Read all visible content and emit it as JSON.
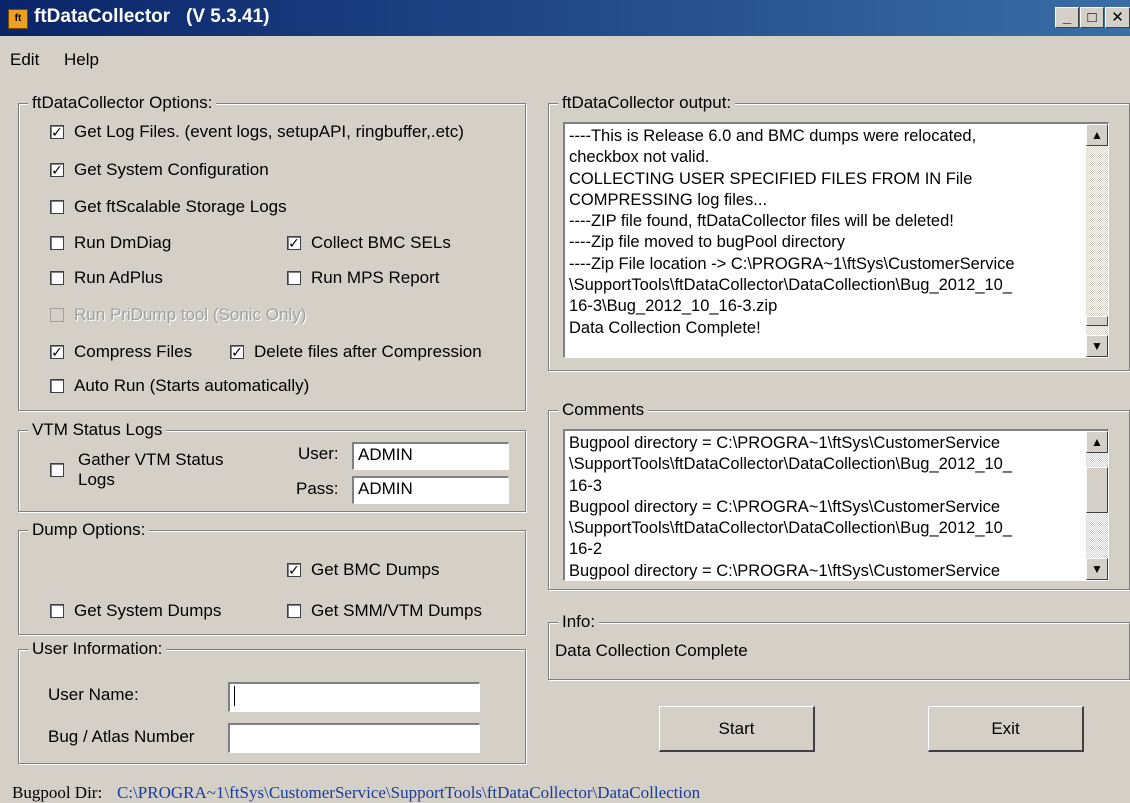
{
  "window": {
    "title": "ftDataCollector   (V 5.3.41)",
    "app_icon_text": "ft",
    "minimize": "_",
    "maximize": "□",
    "close": "✕"
  },
  "menu": {
    "items": [
      "Edit",
      "Help"
    ]
  },
  "options": {
    "legend": "ftDataCollector Options:",
    "get_log_files": {
      "label": "Get Log Files. (event logs, setupAPI, ringbuffer,.etc)",
      "checked": true
    },
    "get_system_config": {
      "label": "Get System Configuration",
      "checked": true
    },
    "get_storage_logs": {
      "label": "Get ftScalable Storage Logs",
      "checked": false
    },
    "run_dmdiag": {
      "label": "Run DmDiag",
      "checked": false
    },
    "collect_bmc_sels": {
      "label": "Collect BMC SELs",
      "checked": true
    },
    "run_adplus": {
      "label": "Run AdPlus",
      "checked": false
    },
    "run_mps_report": {
      "label": "Run MPS Report",
      "checked": false
    },
    "run_pridump": {
      "label": "Run PriDump tool (Sonic Only)",
      "checked": false,
      "disabled": true
    },
    "compress_files": {
      "label": "Compress Files",
      "checked": true
    },
    "delete_after_compression": {
      "label": "Delete files after Compression",
      "checked": true
    },
    "auto_run": {
      "label": "Auto Run (Starts automatically)",
      "checked": false
    }
  },
  "vtm": {
    "legend": "VTM Status Logs",
    "gather": {
      "label_line1": "Gather VTM Status",
      "label_line2": "Logs",
      "checked": false
    },
    "user_label": "User:",
    "user_value": "ADMIN",
    "pass_label": "Pass:",
    "pass_value": "ADMIN"
  },
  "dump": {
    "legend": "Dump Options:",
    "get_bmc_dumps": {
      "label": "Get BMC Dumps",
      "checked": true
    },
    "get_system_dumps": {
      "label": "Get System Dumps",
      "checked": false
    },
    "get_smm_vtm_dumps": {
      "label": "Get SMM/VTM Dumps",
      "checked": false
    }
  },
  "user_info": {
    "legend": "User Information:",
    "user_name_label": "User Name:",
    "user_name_value": "",
    "bug_label": "Bug / Atlas Number",
    "bug_value": ""
  },
  "output": {
    "legend": "ftDataCollector output:",
    "lines": [
      "----This is Release 6.0 and BMC dumps were relocated,",
      "checkbox not valid.",
      "COLLECTING USER SPECIFIED FILES FROM IN File",
      "COMPRESSING log files...",
      "----ZIP file found, ftDataCollector files will be deleted!",
      "----Zip file moved to bugPool directory",
      "----Zip File location -> C:\\PROGRA~1\\ftSys\\CustomerService",
      "\\SupportTools\\ftDataCollector\\DataCollection\\Bug_2012_10_",
      "16-3\\Bug_2012_10_16-3.zip",
      "Data Collection Complete!"
    ]
  },
  "comments": {
    "legend": "Comments",
    "lines": [
      "Bugpool directory = C:\\PROGRA~1\\ftSys\\CustomerService",
      "\\SupportTools\\ftDataCollector\\DataCollection\\Bug_2012_10_",
      "16-3",
      "Bugpool directory = C:\\PROGRA~1\\ftSys\\CustomerService",
      "\\SupportTools\\ftDataCollector\\DataCollection\\Bug_2012_10_",
      "16-2",
      "Bugpool directory = C:\\PROGRA~1\\ftSys\\CustomerService"
    ]
  },
  "info": {
    "legend": "Info:",
    "text": "Data Collection Complete"
  },
  "buttons": {
    "start": "Start",
    "exit": "Exit"
  },
  "scroll": {
    "up_arrow": "▲",
    "down_arrow": "▼"
  },
  "bugpool": {
    "label": "Bugpool Dir:",
    "path": "C:\\PROGRA~1\\ftSys\\CustomerService\\SupportTools\\ftDataCollector\\DataCollection",
    "path_color": "#1a3c9a"
  }
}
